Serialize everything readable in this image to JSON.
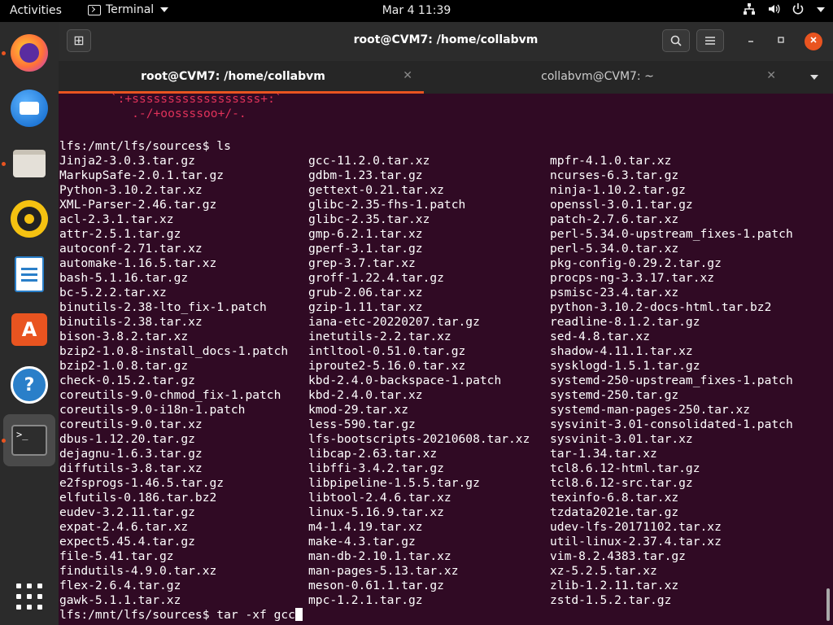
{
  "topbar": {
    "activities": "Activities",
    "app_name": "Terminal",
    "clock": "Mar 4  11:39"
  },
  "dock": {
    "items": [
      {
        "name": "firefox",
        "running": true
      },
      {
        "name": "thunderbird",
        "running": false
      },
      {
        "name": "files",
        "running": true
      },
      {
        "name": "rhythmbox",
        "running": false
      },
      {
        "name": "libreoffice-writer",
        "running": false
      },
      {
        "name": "software-center",
        "running": false
      },
      {
        "name": "help",
        "running": false
      },
      {
        "name": "terminal",
        "running": true
      }
    ],
    "help_glyph": "?",
    "show_apps_icon": "app-grid-icon"
  },
  "window": {
    "title": "root@CVM7: /home/collabvm",
    "tabs": [
      {
        "label": "root@CVM7: /home/collabvm",
        "active": true
      },
      {
        "label": "collabvm@CVM7: ~",
        "active": false
      }
    ]
  },
  "terminal": {
    "art": [
      " `:+ssssssssssssssssss+:` ",
      "    .-/+oossssoo+/-.    "
    ],
    "prompt_ls": "lfs:/mnt/lfs/sources$ ls",
    "files": {
      "col1": [
        "Jinja2-3.0.3.tar.gz",
        "MarkupSafe-2.0.1.tar.gz",
        "Python-3.10.2.tar.xz",
        "XML-Parser-2.46.tar.gz",
        "acl-2.3.1.tar.xz",
        "attr-2.5.1.tar.gz",
        "autoconf-2.71.tar.xz",
        "automake-1.16.5.tar.xz",
        "bash-5.1.16.tar.gz",
        "bc-5.2.2.tar.xz",
        "binutils-2.38-lto_fix-1.patch",
        "binutils-2.38.tar.xz",
        "bison-3.8.2.tar.xz",
        "bzip2-1.0.8-install_docs-1.patch",
        "bzip2-1.0.8.tar.gz",
        "check-0.15.2.tar.gz",
        "coreutils-9.0-chmod_fix-1.patch",
        "coreutils-9.0-i18n-1.patch",
        "coreutils-9.0.tar.xz",
        "dbus-1.12.20.tar.gz",
        "dejagnu-1.6.3.tar.gz",
        "diffutils-3.8.tar.xz",
        "e2fsprogs-1.46.5.tar.gz",
        "elfutils-0.186.tar.bz2",
        "eudev-3.2.11.tar.gz",
        "expat-2.4.6.tar.xz",
        "expect5.45.4.tar.gz",
        "file-5.41.tar.gz",
        "findutils-4.9.0.tar.xz",
        "flex-2.6.4.tar.gz",
        "gawk-5.1.1.tar.xz"
      ],
      "col2": [
        "gcc-11.2.0.tar.xz",
        "gdbm-1.23.tar.gz",
        "gettext-0.21.tar.xz",
        "glibc-2.35-fhs-1.patch",
        "glibc-2.35.tar.xz",
        "gmp-6.2.1.tar.xz",
        "gperf-3.1.tar.gz",
        "grep-3.7.tar.xz",
        "groff-1.22.4.tar.gz",
        "grub-2.06.tar.xz",
        "gzip-1.11.tar.xz",
        "iana-etc-20220207.tar.gz",
        "inetutils-2.2.tar.xz",
        "intltool-0.51.0.tar.gz",
        "iproute2-5.16.0.tar.xz",
        "kbd-2.4.0-backspace-1.patch",
        "kbd-2.4.0.tar.xz",
        "kmod-29.tar.xz",
        "less-590.tar.gz",
        "lfs-bootscripts-20210608.tar.xz",
        "libcap-2.63.tar.xz",
        "libffi-3.4.2.tar.gz",
        "libpipeline-1.5.5.tar.gz",
        "libtool-2.4.6.tar.xz",
        "linux-5.16.9.tar.xz",
        "m4-1.4.19.tar.xz",
        "make-4.3.tar.gz",
        "man-db-2.10.1.tar.xz",
        "man-pages-5.13.tar.xz",
        "meson-0.61.1.tar.gz",
        "mpc-1.2.1.tar.gz"
      ],
      "col3": [
        "mpfr-4.1.0.tar.xz",
        "ncurses-6.3.tar.gz",
        "ninja-1.10.2.tar.gz",
        "openssl-3.0.1.tar.gz",
        "patch-2.7.6.tar.xz",
        "perl-5.34.0-upstream_fixes-1.patch",
        "perl-5.34.0.tar.xz",
        "pkg-config-0.29.2.tar.gz",
        "procps-ng-3.3.17.tar.xz",
        "psmisc-23.4.tar.xz",
        "python-3.10.2-docs-html.tar.bz2",
        "readline-8.1.2.tar.gz",
        "sed-4.8.tar.xz",
        "shadow-4.11.1.tar.xz",
        "sysklogd-1.5.1.tar.gz",
        "systemd-250-upstream_fixes-1.patch",
        "systemd-250.tar.gz",
        "systemd-man-pages-250.tar.xz",
        "sysvinit-3.01-consolidated-1.patch",
        "sysvinit-3.01.tar.xz",
        "tar-1.34.tar.xz",
        "tcl8.6.12-html.tar.gz",
        "tcl8.6.12-src.tar.gz",
        "texinfo-6.8.tar.xz",
        "tzdata2021e.tar.gz",
        "udev-lfs-20171102.tar.xz",
        "util-linux-2.37.4.tar.xz",
        "vim-8.2.4383.tar.gz",
        "xz-5.2.5.tar.xz",
        "zlib-1.2.11.tar.xz",
        "zstd-1.5.2.tar.gz"
      ]
    },
    "prompt_current": "lfs:/mnt/lfs/sources$ tar -xf gcc"
  },
  "colors": {
    "accent": "#e95420",
    "terminal_bg": "#300a24",
    "art_red": "#e0325a"
  }
}
